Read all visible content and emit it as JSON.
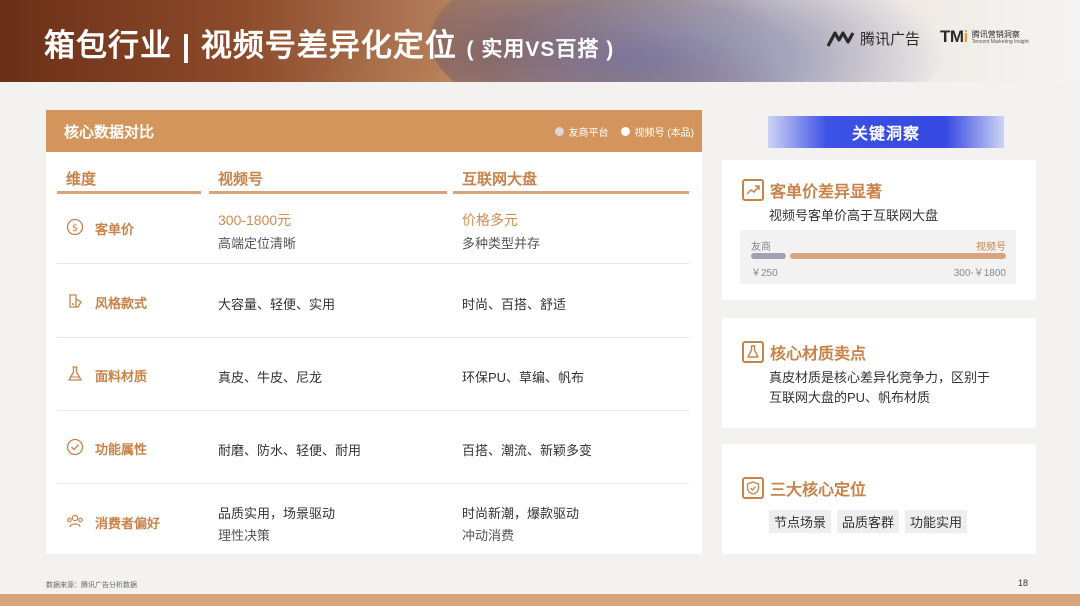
{
  "header": {
    "title": "箱包行业 | 视频号差异化定位",
    "subtitle": "( 实用VS百搭 )",
    "logo_tencent_ads": "腾讯广告",
    "logo_tmi": "TMI",
    "logo_tmi_cn": "腾讯营销洞察",
    "logo_tmi_en": "Tencent Marketing Insight"
  },
  "comparison": {
    "title": "核心数据对比",
    "legend": [
      {
        "label": "友商平台",
        "color": "#d9d9d9"
      },
      {
        "label": "视频号 (本品)",
        "color": "#ffffff"
      }
    ],
    "columns": [
      "维度",
      "视频号",
      "互联网大盘"
    ],
    "rows": [
      {
        "icon": "dollar-icon",
        "label": "客单价",
        "video_main": "300-1800元",
        "video_sub": "高端定位清晰",
        "market_main": "价格多元",
        "market_sub": "多种类型并存"
      },
      {
        "icon": "style-icon",
        "label": "风格款式",
        "video_main": "大容量、轻便、实用",
        "market_main": "时尚、百搭、舒适"
      },
      {
        "icon": "flask-icon",
        "label": "面料材质",
        "video_main": "真皮、牛皮、尼龙",
        "market_main": "环保PU、草编、帆布"
      },
      {
        "icon": "check-circle-icon",
        "label": "功能属性",
        "video_main": "耐磨、防水、轻便、耐用",
        "market_main": "百搭、潮流、新颖多变"
      },
      {
        "icon": "users-icon",
        "label": "消费者偏好",
        "video_main": "品质实用，场景驱动",
        "video_sub": "理性决策",
        "market_main": "时尚新潮，爆款驱动",
        "market_sub": "冲动消费"
      }
    ]
  },
  "insights": {
    "title": "关键洞察",
    "cards": [
      {
        "icon": "trend-up-icon",
        "title": "客单价差异显著",
        "text": "视频号客单价高于互联网大盘",
        "compare": {
          "left_label": "友商",
          "right_label": "视频号",
          "left_value": "￥250",
          "right_value": "300-￥1800",
          "left_fraction": 0.14
        }
      },
      {
        "icon": "flask-icon",
        "title": "核心材质卖点",
        "text_lines": [
          "真皮材质是核心差异化竞争力，区别于",
          "互联网大盘的PU、帆布材质"
        ]
      },
      {
        "icon": "shield-check-icon",
        "title": "三大核心定位",
        "tags": [
          "节点场景",
          "品质客群",
          "功能实用"
        ]
      }
    ]
  },
  "footer": {
    "source": "数据来源：腾讯广告分析数据",
    "page": "18"
  }
}
